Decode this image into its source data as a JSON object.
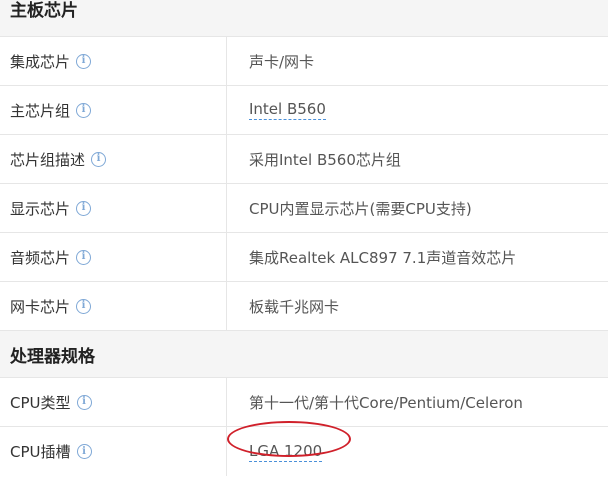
{
  "sections": [
    {
      "title": "主板芯片",
      "rows": [
        {
          "name": "集成芯片",
          "value": "声卡/网卡"
        },
        {
          "name": "主芯片组",
          "value": "Intel B560"
        },
        {
          "name": "芯片组描述",
          "value": "采用Intel B560芯片组"
        },
        {
          "name": "显示芯片",
          "value": "CPU内置显示芯片(需要CPU支持)"
        },
        {
          "name": "音频芯片",
          "value": "集成Realtek ALC897 7.1声道音效芯片"
        },
        {
          "name": "网卡芯片",
          "value": "板载千兆网卡"
        }
      ]
    },
    {
      "title": "处理器规格",
      "rows": [
        {
          "name": "CPU类型",
          "value": "第十一代/第十代Core/Pentium/Celeron"
        },
        {
          "name": "CPU插槽",
          "value": "LGA 1200"
        }
      ]
    }
  ],
  "info_icon_glyph": "i",
  "colors": {
    "info_icon": "#7fa8d6",
    "link_underline": "#4a90d9",
    "annotation_circle": "#d0202a"
  }
}
